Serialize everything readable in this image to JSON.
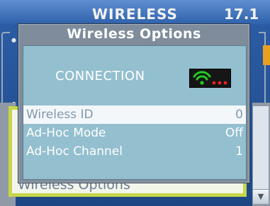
{
  "background_app": {
    "header_title": "WIRELESS",
    "version": "17.1",
    "panel_label": "Wireless Options",
    "scroll_down_icon": "chevron-down-icon"
  },
  "dialog": {
    "title": "Wireless Options",
    "connection_label": "CONNECTION",
    "signal_icon": "wifi-signal-icon",
    "signal_colors": {
      "wifi": "#22cc22",
      "dots": "#ff2020",
      "box": "#161616"
    },
    "settings": [
      {
        "label": "Wireless ID",
        "value": "0",
        "selected": true
      },
      {
        "label": "Ad-Hoc Mode",
        "value": "Off",
        "selected": false
      },
      {
        "label": "Ad-Hoc Channel",
        "value": "1",
        "selected": false
      }
    ]
  }
}
